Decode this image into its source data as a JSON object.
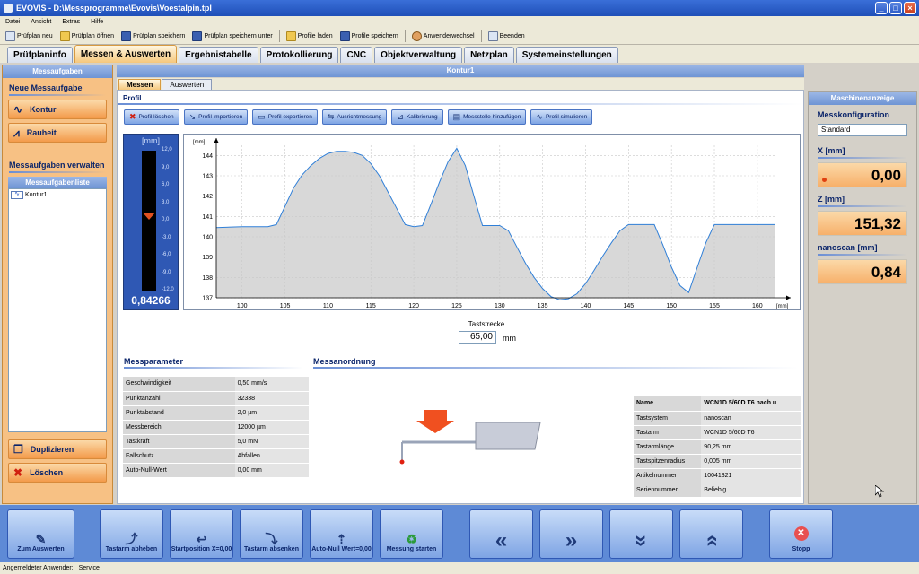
{
  "window": {
    "title": "EVOVIS - D:\\Messprogramme\\Evovis\\Voestalpin.tpl"
  },
  "menu": [
    "Datei",
    "Ansicht",
    "Extras",
    "Hilfe"
  ],
  "toolbar": [
    "Prüfplan neu",
    "Prüfplan öffnen",
    "Prüfplan speichern",
    "Prüfplan speichern unter",
    "Profile laden",
    "Profile speichern",
    "Anwenderwechsel",
    "Beenden"
  ],
  "main_tabs": [
    "Prüfplaninfo",
    "Messen & Auswerten",
    "Ergebnistabelle",
    "Protokollierung",
    "CNC",
    "Objektverwaltung",
    "Netzplan",
    "Systemeinstellungen"
  ],
  "left": {
    "header": "Messaufgaben",
    "new_title": "Neue Messaufgabe",
    "btn_kontur": "Kontur",
    "btn_rauheit": "Rauheit",
    "manage_title": "Messaufgaben verwalten",
    "list_header": "Messaufgabenliste",
    "items": [
      "Kontur1"
    ],
    "btn_duplizieren": "Duplizieren",
    "btn_loeschen": "Löschen"
  },
  "center": {
    "header": "Kontur1",
    "sub_tabs": [
      "Messen",
      "Auswerten"
    ],
    "profil_title": "Profil",
    "profil_buttons": [
      "Profil löschen",
      "Profil importieren",
      "Profil exportieren",
      "Ausrichtmessung",
      "Kalibrierung",
      "Messstelle hinzufügen",
      "Profil simulieren"
    ],
    "taststrecke_label": "Taststrecke",
    "taststrecke_value": "65,00",
    "taststrecke_unit": "mm",
    "messparameter_title": "Messparameter",
    "messanordnung_title": "Messanordnung",
    "params": [
      [
        "Geschwindigkeit",
        "0,50 mm/s"
      ],
      [
        "Punktanzahl",
        "32338"
      ],
      [
        "Punktabstand",
        "2,0 µm"
      ],
      [
        "Messbereich",
        "12000 µm"
      ],
      [
        "Tastkraft",
        "5,0 mN"
      ],
      [
        "Fallschutz",
        "Abfallen"
      ],
      [
        "Auto-Null-Wert",
        "0,00 mm"
      ]
    ],
    "tast": [
      [
        "Name",
        "WCN1D 5/60D T6 nach u"
      ],
      [
        "Tastsystem",
        "nanoscan"
      ],
      [
        "Tastarm",
        "WCN1D 5/60D T6"
      ],
      [
        "Tastarmlänge",
        "90,25 mm"
      ],
      [
        "Tastspitzenradius",
        "0,005 mm"
      ],
      [
        "Artikelnummer",
        "10041321"
      ],
      [
        "Seriennummer",
        "Beliebig"
      ]
    ]
  },
  "gauge": {
    "unit": "[mm]",
    "ticks": [
      "12,0",
      "9,0",
      "6,0",
      "3,0",
      "0,0",
      "-3,0",
      "-6,0",
      "-9,0",
      "-12,0"
    ],
    "value": "0,84266",
    "level": 0.4649
  },
  "chart_data": {
    "type": "line",
    "xlabel": "[mm]",
    "ylabel": "[mm]",
    "xlim": [
      97,
      162
    ],
    "ylim": [
      137,
      144.5
    ],
    "xticks": [
      100,
      105,
      110,
      115,
      120,
      125,
      130,
      135,
      140,
      145,
      150,
      155,
      160
    ],
    "yticks": [
      137,
      138,
      139,
      140,
      141,
      142,
      143,
      144
    ],
    "grid": true,
    "series": [
      {
        "x": [
          97,
          100,
          103,
          104,
          105,
          106,
          107,
          108,
          109,
          110,
          111,
          112,
          113,
          114,
          115,
          116,
          117,
          118,
          119,
          120,
          121,
          122,
          123,
          124,
          125,
          126,
          127,
          128,
          129,
          130,
          131,
          132,
          133,
          134,
          135,
          136,
          137,
          138,
          139,
          140,
          141,
          142,
          143,
          144,
          145,
          146,
          147,
          148,
          149,
          150,
          151,
          152,
          153,
          154,
          155,
          156,
          158,
          160,
          162
        ],
        "y": [
          140.45,
          140.5,
          140.5,
          140.6,
          141.5,
          142.4,
          143.05,
          143.5,
          143.85,
          144.1,
          144.2,
          144.2,
          144.15,
          144.0,
          143.6,
          143.0,
          142.2,
          141.4,
          140.6,
          140.5,
          140.55,
          141.6,
          142.7,
          143.7,
          144.35,
          143.5,
          142.0,
          140.55,
          140.55,
          140.55,
          140.3,
          139.5,
          138.7,
          138.0,
          137.45,
          137.05,
          136.9,
          136.95,
          137.2,
          137.7,
          138.35,
          139.05,
          139.7,
          140.3,
          140.6,
          140.6,
          140.6,
          140.6,
          139.6,
          138.5,
          137.6,
          137.25,
          138.5,
          139.7,
          140.6,
          140.6,
          140.6,
          140.6,
          140.6
        ]
      }
    ]
  },
  "right": {
    "header": "Maschinenanzeige",
    "config_label": "Messkonfiguration",
    "config_value": "Standard",
    "x_label": "X [mm]",
    "x_value": "0,00",
    "z_label": "Z [mm]",
    "z_value": "151,32",
    "n_label": "nanoscan [mm]",
    "n_value": "0,84"
  },
  "bottom": {
    "zum_auswerten": "Zum Auswerten",
    "tastarm_abheben": "Tastarm abheben",
    "startposition": "Startposition X=0,00",
    "tastarm_absenken": "Tastarm absenken",
    "auto_null": "Auto-Null Wert=0,00",
    "messung_starten": "Messung starten",
    "stopp": "Stopp"
  },
  "status": {
    "label": "Angemeldeter Anwender:",
    "user": "Service"
  },
  "colors": {
    "accent": "#f39a4a",
    "blue": "#2f58b4",
    "curve": "#2f7fd8",
    "fill": "#d8d8d8"
  }
}
